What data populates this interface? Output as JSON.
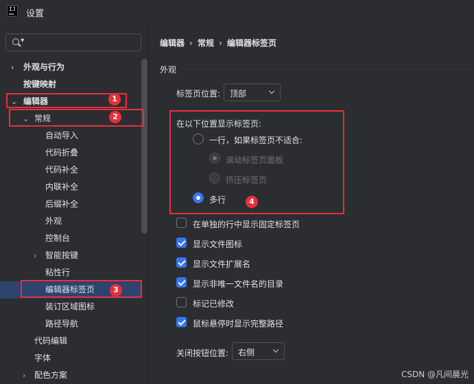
{
  "window": {
    "title": "设置"
  },
  "search": {
    "placeholder": ""
  },
  "tree": [
    {
      "label": "外观与行为",
      "chevron": "›",
      "bold": true
    },
    {
      "label": "按键映射",
      "chevron": "",
      "bold": true
    },
    {
      "label": "编辑器",
      "chevron": "⌄",
      "bold": true
    },
    {
      "label": "常规",
      "chevron": "⌄",
      "bold": false
    },
    {
      "label": "自动导入",
      "chevron": "",
      "bold": false
    },
    {
      "label": "代码折叠",
      "chevron": "",
      "bold": false
    },
    {
      "label": "代码补全",
      "chevron": "",
      "bold": false
    },
    {
      "label": "内联补全",
      "chevron": "",
      "bold": false
    },
    {
      "label": "后缀补全",
      "chevron": "",
      "bold": false
    },
    {
      "label": "外观",
      "chevron": "",
      "bold": false
    },
    {
      "label": "控制台",
      "chevron": "",
      "bold": false
    },
    {
      "label": "智能按键",
      "chevron": "›",
      "bold": false
    },
    {
      "label": "粘性行",
      "chevron": "",
      "bold": false
    },
    {
      "label": "编辑器标签页",
      "chevron": "",
      "bold": false,
      "selected": true
    },
    {
      "label": "装订区域图标",
      "chevron": "",
      "bold": false
    },
    {
      "label": "路径导航",
      "chevron": "",
      "bold": false
    },
    {
      "label": "代码编辑",
      "chevron": "",
      "bold": false
    },
    {
      "label": "字体",
      "chevron": "",
      "bold": false
    },
    {
      "label": "配色方案",
      "chevron": "›",
      "bold": false
    }
  ],
  "breadcrumb": [
    "编辑器",
    "常规",
    "编辑器标签页"
  ],
  "breadcrumb_sep": "›",
  "section": {
    "title": "外观"
  },
  "tab_position": {
    "label": "标签页位置:",
    "value": "顶部"
  },
  "show_tabs_in": {
    "label": "在以下位置显示标签页:",
    "single_row": "一行，如果标签页不适合:",
    "scroll": "滚动标签页面板",
    "squeeze": "挤压标签页",
    "multiple_rows": "多行"
  },
  "checkboxes": [
    {
      "label": "在单独的行中显示固定标签页",
      "checked": false
    },
    {
      "label": "显示文件图标",
      "checked": true
    },
    {
      "label": "显示文件扩展名",
      "checked": true
    },
    {
      "label": "显示非唯一文件名的目录",
      "checked": true
    },
    {
      "label": "标记已修改",
      "checked": false
    },
    {
      "label": "鼠标悬停时显示完整路径",
      "checked": true
    }
  ],
  "close_button": {
    "label": "关闭按钮位置:",
    "value": "右侧"
  },
  "annotations": [
    "1",
    "2",
    "3",
    "4"
  ],
  "watermark": "CSDN @凡间晨光",
  "colors": {
    "accent": "#3574f0",
    "highlight": "#e8303a",
    "selection": "#2e436e",
    "background": "#2b2d30"
  }
}
